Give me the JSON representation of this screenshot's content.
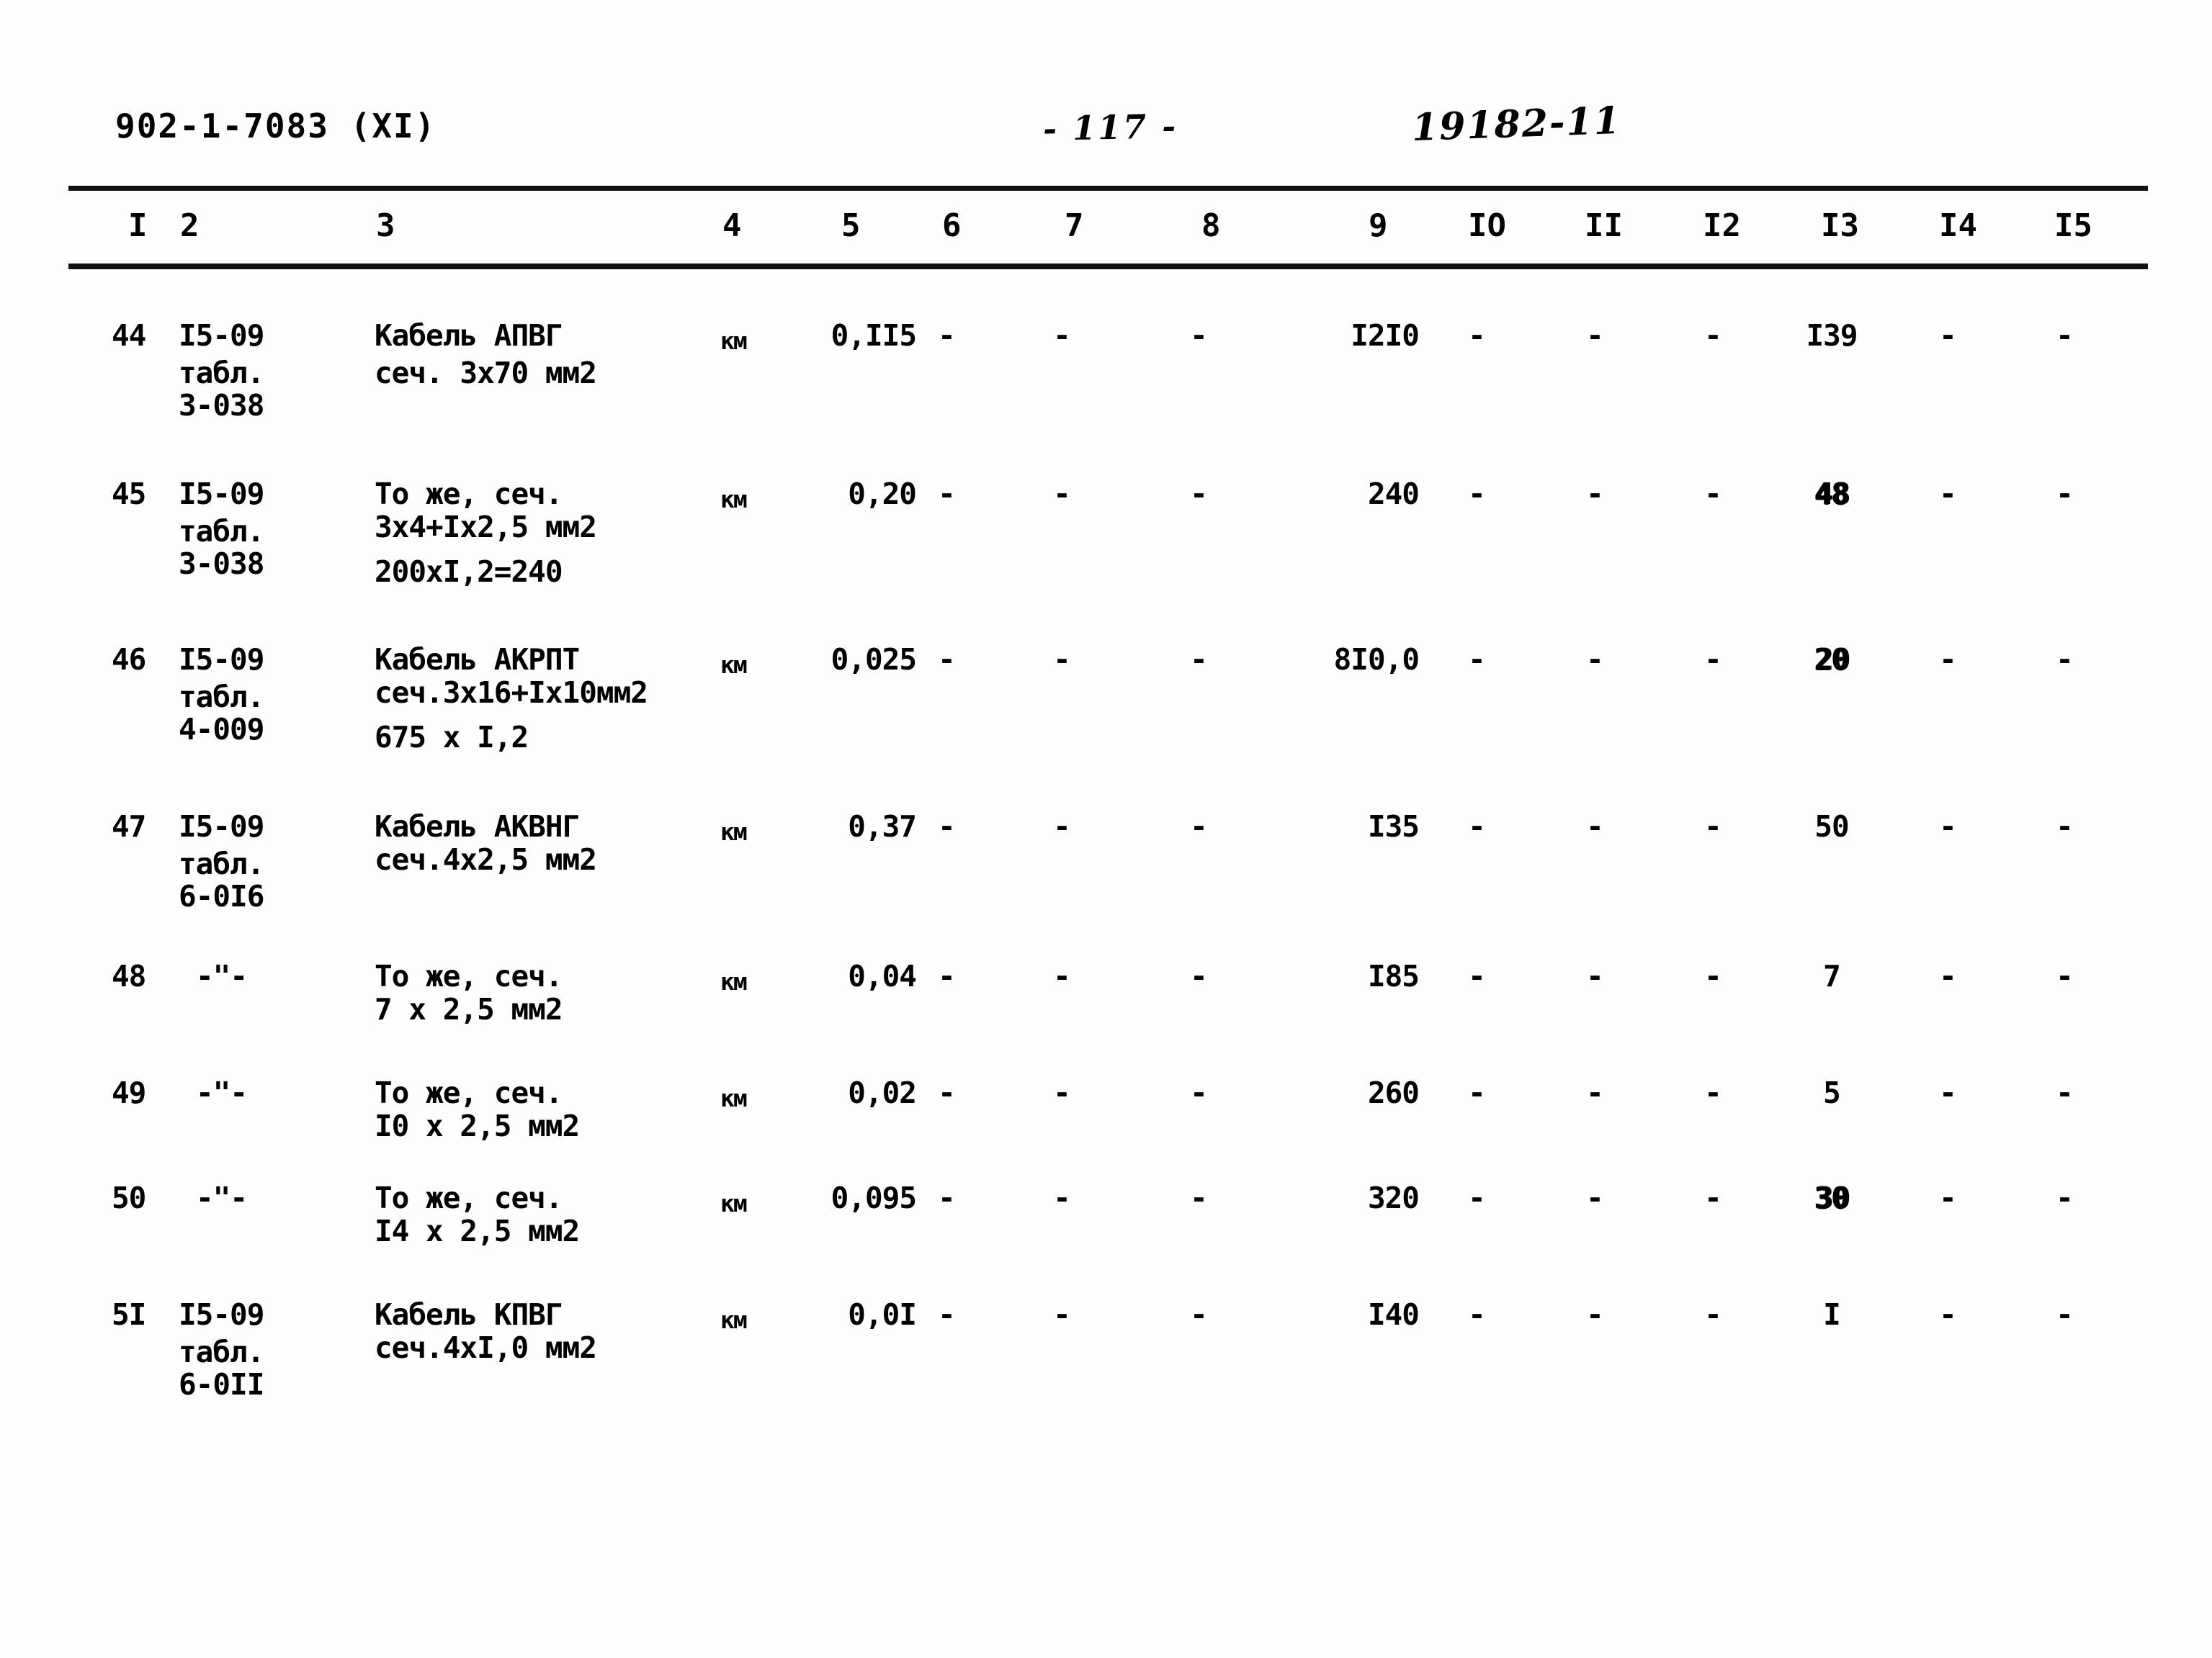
{
  "header": {
    "doc_code": "902-1-7083  (XI)",
    "page_number": "-  117  -",
    "sheet_number": "19182-11"
  },
  "table": {
    "column_headers": [
      "I",
      "2",
      "3",
      "4",
      "5",
      "6",
      "7",
      "8",
      "9",
      "IO",
      "II",
      "I2",
      "I3",
      "I4",
      "I5"
    ],
    "rows": [
      {
        "c1": "44",
        "c2": [
          "I5-09",
          "табл.",
          "3-038"
        ],
        "c3": [
          "Кабель АПВГ",
          "сеч. 3х70 мм2"
        ],
        "c4": "км",
        "c5": "0,II5",
        "c6": "-",
        "c7": "-",
        "c8": "-",
        "c9": "I2I0",
        "c10": "-",
        "c11": "-",
        "c12": "-",
        "c13": "I39",
        "c14": "-",
        "c15": "-"
      },
      {
        "c1": "45",
        "c2": [
          "I5-09",
          "табл.",
          "3-038"
        ],
        "c3": [
          "То же, сеч.",
          "3х4+Iх2,5 мм2",
          "200хI,2=240"
        ],
        "c4": "км",
        "c5": "0,20",
        "c6": "-",
        "c7": "-",
        "c8": "-",
        "c9": "240",
        "c10": "-",
        "c11": "-",
        "c12": "-",
        "c13": "48",
        "c14": "-",
        "c15": "-"
      },
      {
        "c1": "46",
        "c2": [
          "I5-09",
          "табл.",
          "4-009"
        ],
        "c3": [
          "Кабель АКРПТ",
          "сеч.3х16+Iх10мм2",
          "675 х I,2"
        ],
        "c4": "км",
        "c5": "0,025",
        "c6": "-",
        "c7": "-",
        "c8": "-",
        "c9": "8I0,0",
        "c10": "-",
        "c11": "-",
        "c12": "-",
        "c13": "20",
        "c14": "-",
        "c15": "-"
      },
      {
        "c1": "47",
        "c2": [
          "I5-09",
          "табл.",
          "6-0I6"
        ],
        "c3": [
          "Кабель АКВНГ",
          "сеч.4х2,5 мм2"
        ],
        "c4": "км",
        "c5": "0,37",
        "c6": "-",
        "c7": "-",
        "c8": "-",
        "c9": "I35",
        "c10": "-",
        "c11": "-",
        "c12": "-",
        "c13": "50",
        "c14": "-",
        "c15": "-"
      },
      {
        "c1": "48",
        "c2": [
          "-\"-"
        ],
        "c3": [
          "То же, сеч.",
          "7 х 2,5 мм2"
        ],
        "c4": "км",
        "c5": "0,04",
        "c6": "-",
        "c7": "-",
        "c8": "-",
        "c9": "I85",
        "c10": "-",
        "c11": "-",
        "c12": "-",
        "c13": "7",
        "c14": "-",
        "c15": "-"
      },
      {
        "c1": "49",
        "c2": [
          "-\"-"
        ],
        "c3": [
          "То же, сеч.",
          "I0 х 2,5 мм2"
        ],
        "c4": "км",
        "c5": "0,02",
        "c6": "-",
        "c7": "-",
        "c8": "-",
        "c9": "260",
        "c10": "-",
        "c11": "-",
        "c12": "-",
        "c13": "5",
        "c14": "-",
        "c15": "-"
      },
      {
        "c1": "50",
        "c2": [
          "-\"-"
        ],
        "c3": [
          "То же, сеч.",
          "I4 х 2,5 мм2"
        ],
        "c4": "км",
        "c5": "0,095",
        "c6": "-",
        "c7": "-",
        "c8": "-",
        "c9": "320",
        "c10": "-",
        "c11": "-",
        "c12": "-",
        "c13": "30",
        "c14": "-",
        "c15": "-"
      },
      {
        "c1": "5I",
        "c2": [
          "I5-09",
          "табл.",
          "6-0II"
        ],
        "c3": [
          "Кабель КПВГ",
          "сеч.4хI,0 мм2"
        ],
        "c4": "км",
        "c5": "0,0I",
        "c6": "-",
        "c7": "-",
        "c8": "-",
        "c9": "I40",
        "c10": "-",
        "c11": "-",
        "c12": "-",
        "c13": "I",
        "c14": "-",
        "c15": "-"
      }
    ]
  }
}
